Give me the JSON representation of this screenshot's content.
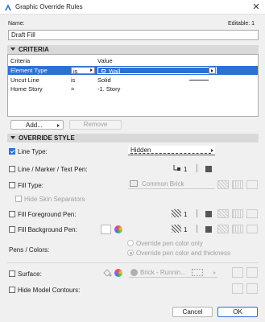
{
  "window": {
    "title": "Graphic Override Rules"
  },
  "name_field": {
    "label": "Name:",
    "editable_label": "Editable: 1",
    "value": "Draft Fill"
  },
  "criteria": {
    "section_title": "CRITERIA",
    "headers": {
      "criteria": "Criteria",
      "value": "Value"
    },
    "rows": [
      {
        "criteria": "Element Type",
        "operator": "is",
        "value": "Wall"
      },
      {
        "criteria": "Uncut Line",
        "operator": "is",
        "value": "Solid"
      },
      {
        "criteria": "Home Story",
        "operator": "=",
        "value": "-1. Story"
      }
    ],
    "add_label": "Add...",
    "remove_label": "Remove"
  },
  "override": {
    "section_title": "OVERRIDE STYLE",
    "line_type": {
      "label": "Line Type:",
      "value": "Hidden",
      "checked": true
    },
    "line_pen": {
      "label": "Line / Marker / Text Pen:",
      "pen_number": "1"
    },
    "fill_type": {
      "label": "Fill Type:",
      "value": "Common Brick"
    },
    "hide_skin": {
      "label": "Hide Skin Separators"
    },
    "fill_fg_pen": {
      "label": "Fill Foreground Pen:",
      "pen_number": "1"
    },
    "fill_bg_pen": {
      "label": "Fill Background Pen:",
      "pen_number": "1"
    },
    "pens_colors": {
      "label": "Pens / Colors:",
      "option1": "Override pen color only",
      "option2": "Override pen color and thickness"
    },
    "surface": {
      "label": "Surface:",
      "value": "Brick - Runnin..."
    },
    "hide_contours": {
      "label": "Hide Model Contours:"
    }
  },
  "footer": {
    "cancel_label": "Cancel",
    "ok_label": "OK"
  },
  "colors": {
    "accent": "#2e6fd6"
  }
}
